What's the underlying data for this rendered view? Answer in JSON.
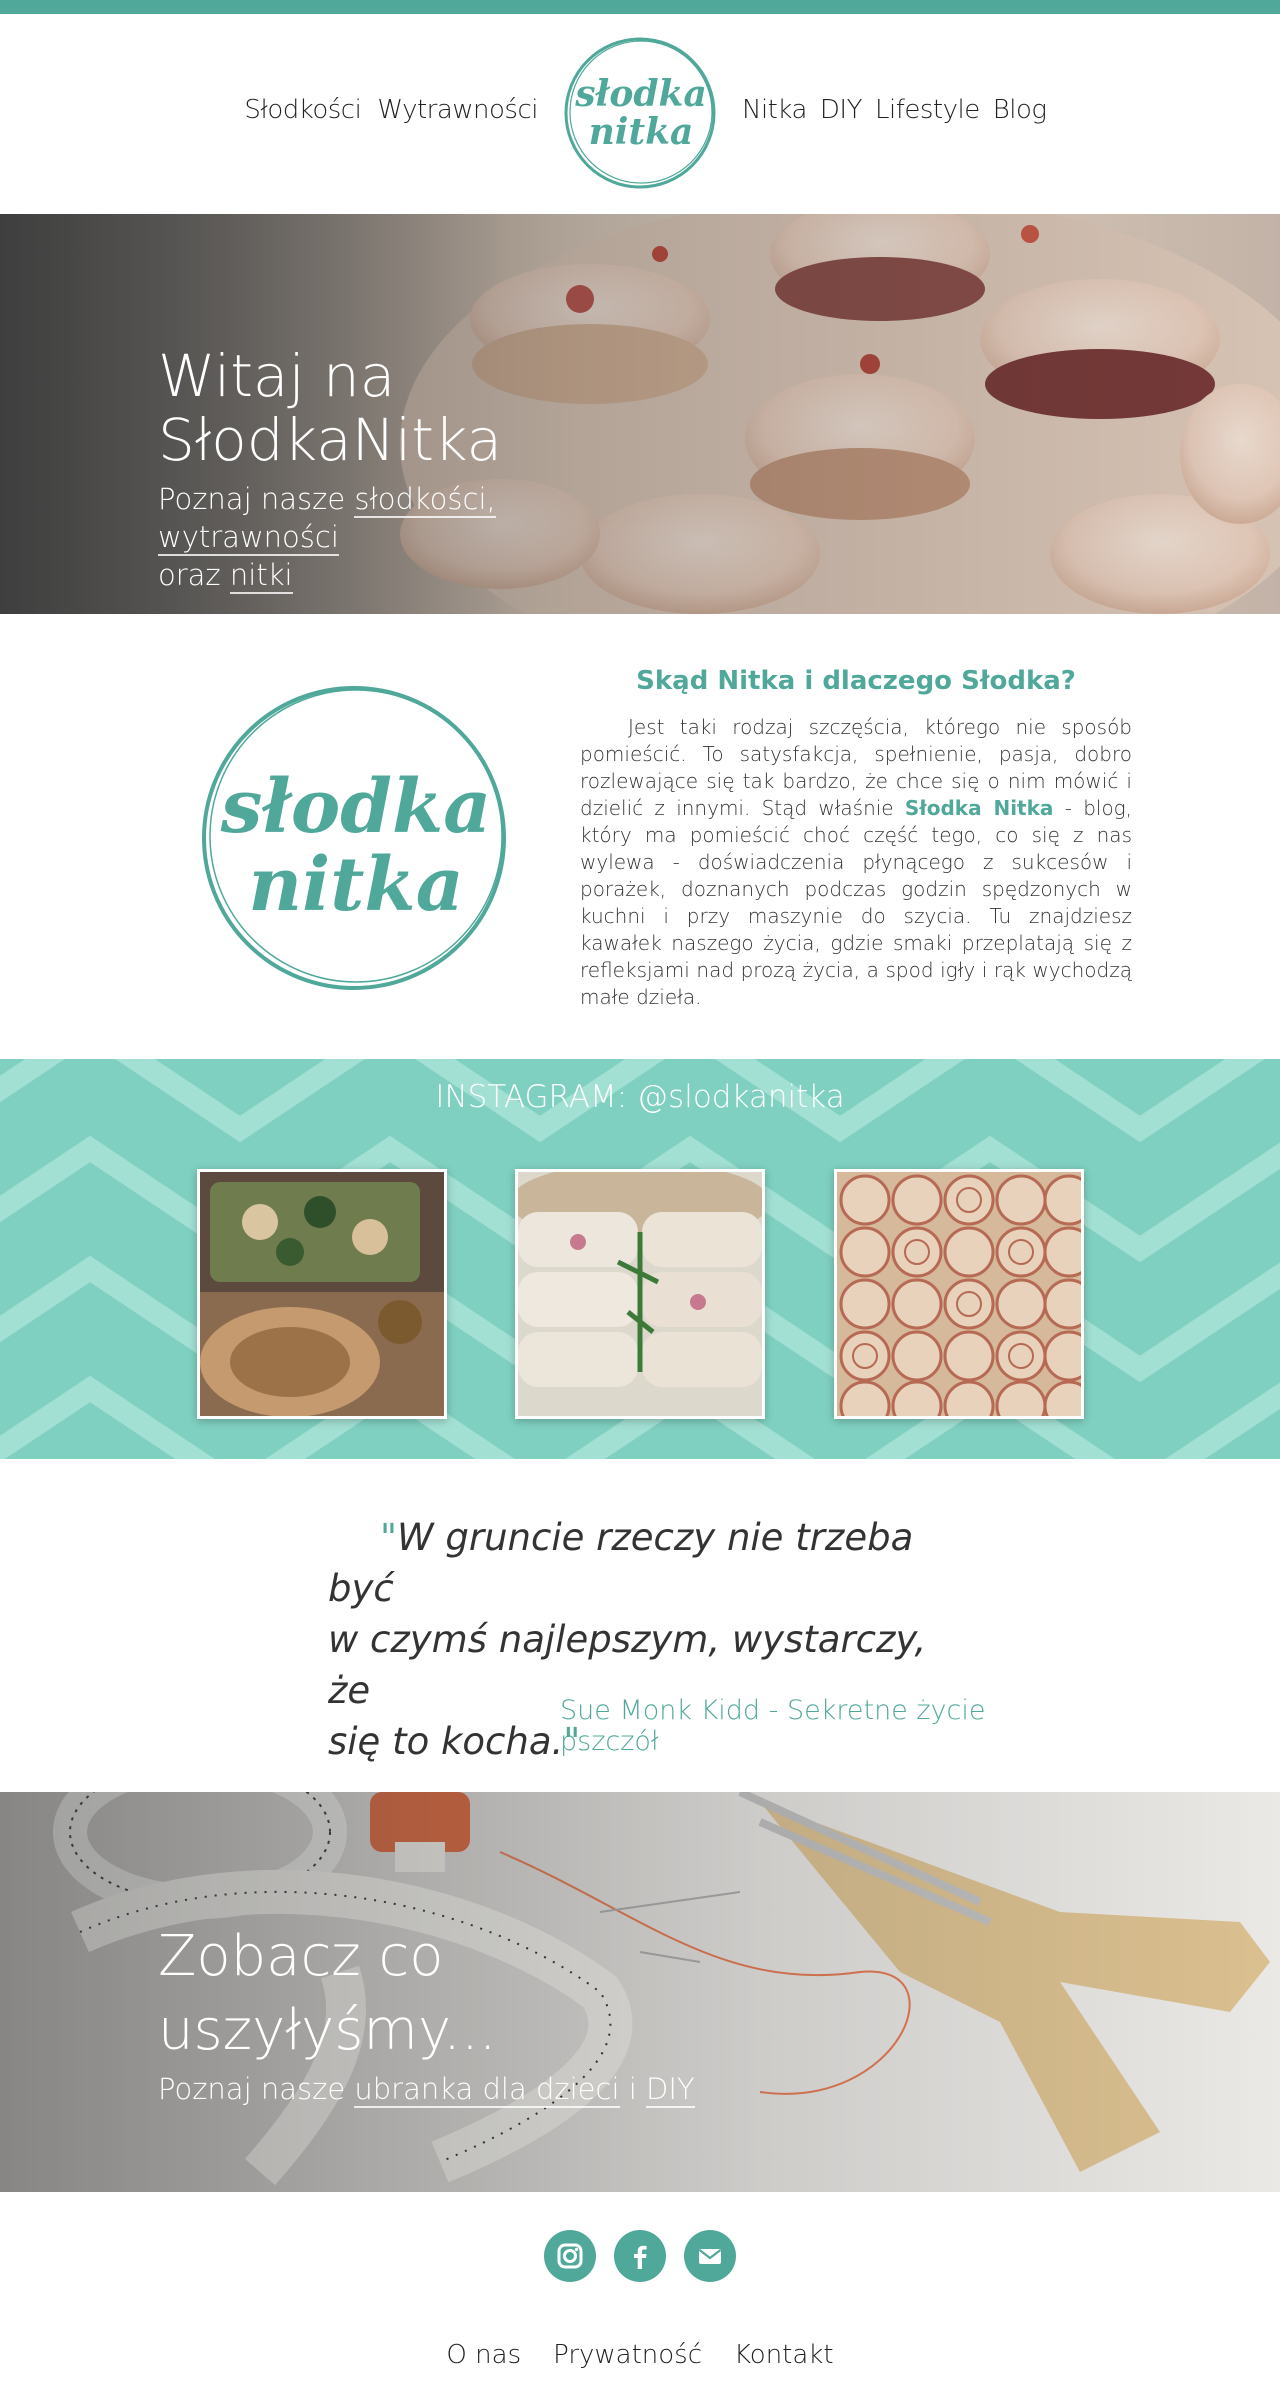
{
  "nav": {
    "left": [
      "Słodkości",
      "Wytrawności"
    ],
    "right": [
      "Nitka",
      "DIY",
      "Lifestyle",
      "Blog"
    ],
    "logo_line1": "słodka",
    "logo_line2": "nitka"
  },
  "hero": {
    "title": "Witaj na SłodkaNitka",
    "sub_prefix": "Poznaj nasze",
    "link_sweets": "słodkości,",
    "link_savory": "wytrawności",
    "sub_oraz": "oraz",
    "link_nitka": "nitki"
  },
  "about": {
    "title": "Skąd Nitka i dlaczego Słodka?",
    "text_before": "Jest taki rodzaj szczęścia, którego nie sposób pomieścić. To satysfakcja, spełnienie, pasja, dobro rozlewające się tak bardzo, że chce się o nim mówić i dzielić z innymi. Stąd właśnie",
    "text_brand": "Słodka Nitka",
    "text_after": "- blog, który ma pomieścić choć część tego, co się z nas wylewa - doświadczenia płynącego z sukcesów i porażek, doznanych podczas godzin spędzonych w kuchni i przy maszynie do szycia. Tu znajdziesz kawałek naszego życia, gdzie smaki przeplatają się z refleksjami nad prozą życia, a spod igły i rąk wychodzą małe dzieła."
  },
  "instagram": {
    "title": "INSTAGRAM: @slodkanitka"
  },
  "quote": {
    "line1": "W gruncie rzeczy nie trzeba być",
    "line2": "w czymś najlepszym, wystarczy, że",
    "line3": "się to kocha.",
    "author": "Sue Monk Kidd - Sekretne życie pszczół"
  },
  "sewing": {
    "title": "Zobacz co uszyłyśmy...",
    "sub_prefix": "Poznaj nasze",
    "link_clothes": "ubranka dla dzieci",
    "sub_i": "i",
    "link_diy": "DIY"
  },
  "footer": {
    "links": [
      "O nas",
      "Prywatność",
      "Kontakt"
    ]
  },
  "colors": {
    "accent": "#4fa89a",
    "instagram_bg": "#7fd0c0"
  }
}
